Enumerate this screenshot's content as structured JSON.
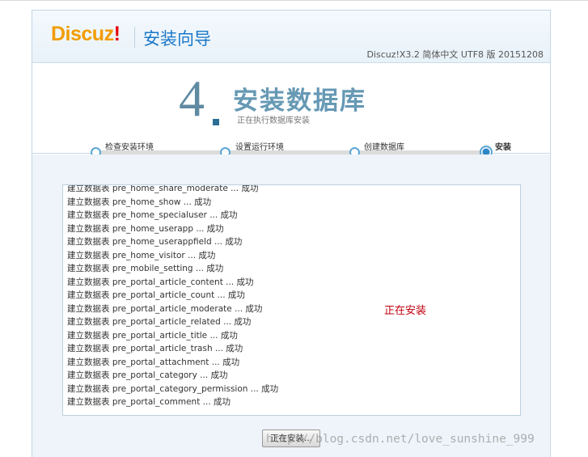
{
  "header": {
    "logo_text": "Discuz",
    "logo_bang": "!",
    "wizard_title": "安装向导",
    "version": "Discuz!X3.2 简体中文 UTF8 版 20151208"
  },
  "step": {
    "number": "4",
    "title": "安装数据库",
    "subtitle": "正在执行数据库安装"
  },
  "steps": [
    {
      "label": "检查安装环境",
      "state": "done"
    },
    {
      "label": "设置运行环境",
      "state": "done"
    },
    {
      "label": "创建数据库",
      "state": "done"
    },
    {
      "label": "安装",
      "state": "current"
    }
  ],
  "log_lines": [
    "建立数据表 pre_home_share_moderate ... 成功",
    "建立数据表 pre_home_show ... 成功",
    "建立数据表 pre_home_specialuser ... 成功",
    "建立数据表 pre_home_userapp ... 成功",
    "建立数据表 pre_home_userappfield ... 成功",
    "建立数据表 pre_home_visitor ... 成功",
    "建立数据表 pre_mobile_setting ... 成功",
    "建立数据表 pre_portal_article_content ... 成功",
    "建立数据表 pre_portal_article_count ... 成功",
    "建立数据表 pre_portal_article_moderate ... 成功",
    "建立数据表 pre_portal_article_related ... 成功",
    "建立数据表 pre_portal_article_title ... 成功",
    "建立数据表 pre_portal_article_trash ... 成功",
    "建立数据表 pre_portal_attachment ... 成功",
    "建立数据表 pre_portal_category ... 成功",
    "建立数据表 pre_portal_category_permission ... 成功",
    "建立数据表 pre_portal_comment ... 成功"
  ],
  "status_text": "正在安装",
  "install_button_label": "正在安装...",
  "watermark": "http://blog.csdn.net/love_sunshine_999",
  "colors": {
    "logo_orange": "#f29c00",
    "logo_red": "#e8000c",
    "wizard_blue": "#1b77c7",
    "step_blue": "#6699b4",
    "status_red": "#c1000f",
    "panel_bg": "#eef4f9"
  }
}
